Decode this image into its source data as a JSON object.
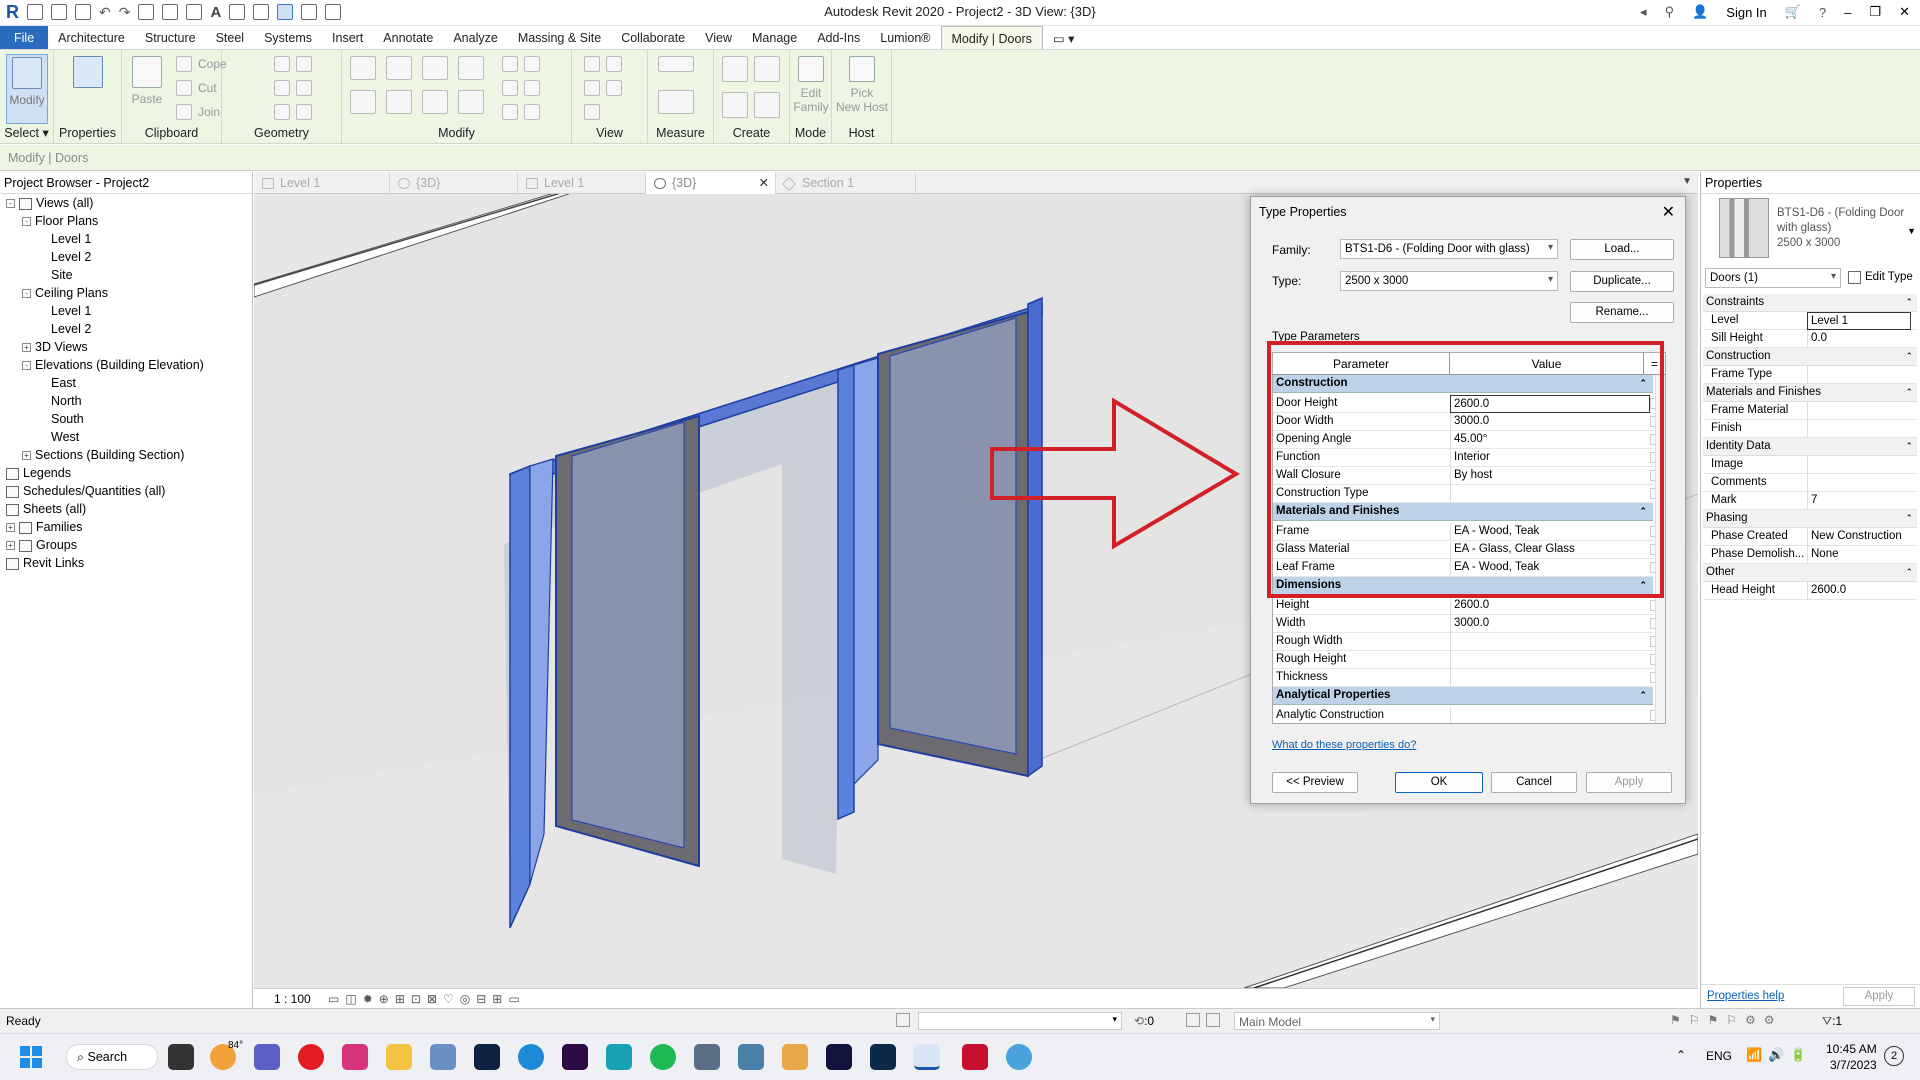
{
  "app": {
    "title": "Autodesk Revit 2020 - Project2 - 3D View: {3D}",
    "sign_in": "Sign In"
  },
  "menu": {
    "tabs": [
      "File",
      "Architecture",
      "Structure",
      "Steel",
      "Systems",
      "Insert",
      "Annotate",
      "Analyze",
      "Massing & Site",
      "Collaborate",
      "View",
      "Manage",
      "Add-Ins",
      "Lumion®",
      "Modify | Doors"
    ]
  },
  "ribbon": {
    "panels": {
      "select": "Select",
      "properties": "Properties",
      "clipboard": "Clipboard",
      "geometry": "Geometry",
      "modify": "Modify",
      "view": "View",
      "measure": "Measure",
      "create": "Create",
      "mode": "Mode",
      "host": "Host"
    },
    "buttons": {
      "modify": "Modify",
      "paste": "Paste",
      "cope": "Cope",
      "cut": "Cut",
      "join": "Join",
      "edit_family_1": "Edit",
      "edit_family_2": "Family",
      "pick_host_1": "Pick",
      "pick_host_2": "New Host"
    }
  },
  "options_bar": "Modify | Doors",
  "project_browser": {
    "title": "Project Browser - Project2",
    "items": [
      {
        "label": "Views (all)",
        "level": 0,
        "toggle": "-",
        "icon": true
      },
      {
        "label": "Floor Plans",
        "level": 1,
        "toggle": "-"
      },
      {
        "label": "Level 1",
        "level": 2
      },
      {
        "label": "Level 2",
        "level": 2
      },
      {
        "label": "Site",
        "level": 2
      },
      {
        "label": "Ceiling Plans",
        "level": 1,
        "toggle": "-"
      },
      {
        "label": "Level 1",
        "level": 2
      },
      {
        "label": "Level 2",
        "level": 2
      },
      {
        "label": "3D Views",
        "level": 1,
        "toggle": "+"
      },
      {
        "label": "Elevations (Building Elevation)",
        "level": 1,
        "toggle": "-"
      },
      {
        "label": "East",
        "level": 2
      },
      {
        "label": "North",
        "level": 2
      },
      {
        "label": "South",
        "level": 2
      },
      {
        "label": "West",
        "level": 2
      },
      {
        "label": "Sections (Building Section)",
        "level": 1,
        "toggle": "+"
      },
      {
        "label": "Legends",
        "level": 0,
        "icon": true
      },
      {
        "label": "Schedules/Quantities (all)",
        "level": 0,
        "icon": true
      },
      {
        "label": "Sheets (all)",
        "level": 0,
        "icon": true
      },
      {
        "label": "Families",
        "level": 0,
        "toggle": "+",
        "icon": true
      },
      {
        "label": "Groups",
        "level": 0,
        "toggle": "+",
        "icon": true
      },
      {
        "label": "Revit Links",
        "level": 0,
        "icon": true
      }
    ]
  },
  "view_tabs": [
    "Level 1",
    "{3D}",
    "Level 1",
    "{3D}",
    "Section 1"
  ],
  "view_scale": "1 : 100",
  "dialog": {
    "title": "Type Properties",
    "family_label": "Family:",
    "family_value": "BTS1-D6 - (Folding Door with glass)",
    "type_label": "Type:",
    "type_value": "2500 x 3000",
    "load": "Load...",
    "duplicate": "Duplicate...",
    "rename": "Rename...",
    "type_params_label": "Type Parameters",
    "col_parameter": "Parameter",
    "col_value": "Value",
    "col_eq": "=",
    "rows": [
      {
        "group": true,
        "name": "Construction"
      },
      {
        "name": "Door Height",
        "value": "2600.0",
        "active": true
      },
      {
        "name": "Door Width",
        "value": "3000.0"
      },
      {
        "name": "Opening Angle",
        "value": "45.00°"
      },
      {
        "name": "Function",
        "value": "Interior"
      },
      {
        "name": "Wall Closure",
        "value": "By host"
      },
      {
        "name": "Construction Type",
        "value": ""
      },
      {
        "group": true,
        "name": "Materials and Finishes"
      },
      {
        "name": "Frame",
        "value": "EA - Wood, Teak"
      },
      {
        "name": "Glass Material",
        "value": "EA - Glass, Clear Glass"
      },
      {
        "name": "Leaf Frame",
        "value": "EA - Wood, Teak"
      },
      {
        "group": true,
        "name": "Dimensions"
      },
      {
        "name": "Height",
        "value": "2600.0"
      },
      {
        "name": "Width",
        "value": "3000.0"
      },
      {
        "name": "Rough Width",
        "value": ""
      },
      {
        "name": "Rough Height",
        "value": ""
      },
      {
        "name": "Thickness",
        "value": ""
      },
      {
        "group": true,
        "name": "Analytical Properties"
      },
      {
        "name": "Analytic Construction",
        "value": ""
      }
    ],
    "help_link": "What do these properties do?",
    "preview": "<< Preview",
    "ok": "OK",
    "cancel": "Cancel",
    "apply": "Apply"
  },
  "properties_palette": {
    "title": "Properties",
    "type_name_1": "BTS1-D6 - (Folding Door",
    "type_name_2": "with glass)",
    "type_name_3": "2500 x 3000",
    "selector": "Doors (1)",
    "edit_type": "Edit Type",
    "rows": [
      {
        "group": true,
        "name": "Constraints"
      },
      {
        "name": "Level",
        "value": "Level 1"
      },
      {
        "name": "Sill Height",
        "value": "0.0"
      },
      {
        "group": true,
        "name": "Construction"
      },
      {
        "name": "Frame Type",
        "value": ""
      },
      {
        "group": true,
        "name": "Materials and Finishes"
      },
      {
        "name": "Frame Material",
        "value": ""
      },
      {
        "name": "Finish",
        "value": ""
      },
      {
        "group": true,
        "name": "Identity Data"
      },
      {
        "name": "Image",
        "value": ""
      },
      {
        "name": "Comments",
        "value": ""
      },
      {
        "name": "Mark",
        "value": "7"
      },
      {
        "group": true,
        "name": "Phasing"
      },
      {
        "name": "Phase Created",
        "value": "New Construction"
      },
      {
        "name": "Phase Demolish...",
        "value": "None"
      },
      {
        "group": true,
        "name": "Other"
      },
      {
        "name": "Head Height",
        "value": "2600.0"
      }
    ],
    "help": "Properties help",
    "apply": "Apply"
  },
  "status": {
    "ready": "Ready",
    "zero": ":0",
    "model": "Main Model",
    "filter": ":1"
  },
  "taskbar": {
    "search": "Search",
    "temp": "84°",
    "lang": "ENG",
    "time": "10:45 AM",
    "date": "3/7/2023",
    "badge": "2"
  },
  "colors": {
    "accent": "#2a6bc0",
    "ribbon_bg": "#eef5e3",
    "selection_blue": "#4d7ad8",
    "highlight_red": "#d32027",
    "group_header": "#bdd2e8"
  }
}
